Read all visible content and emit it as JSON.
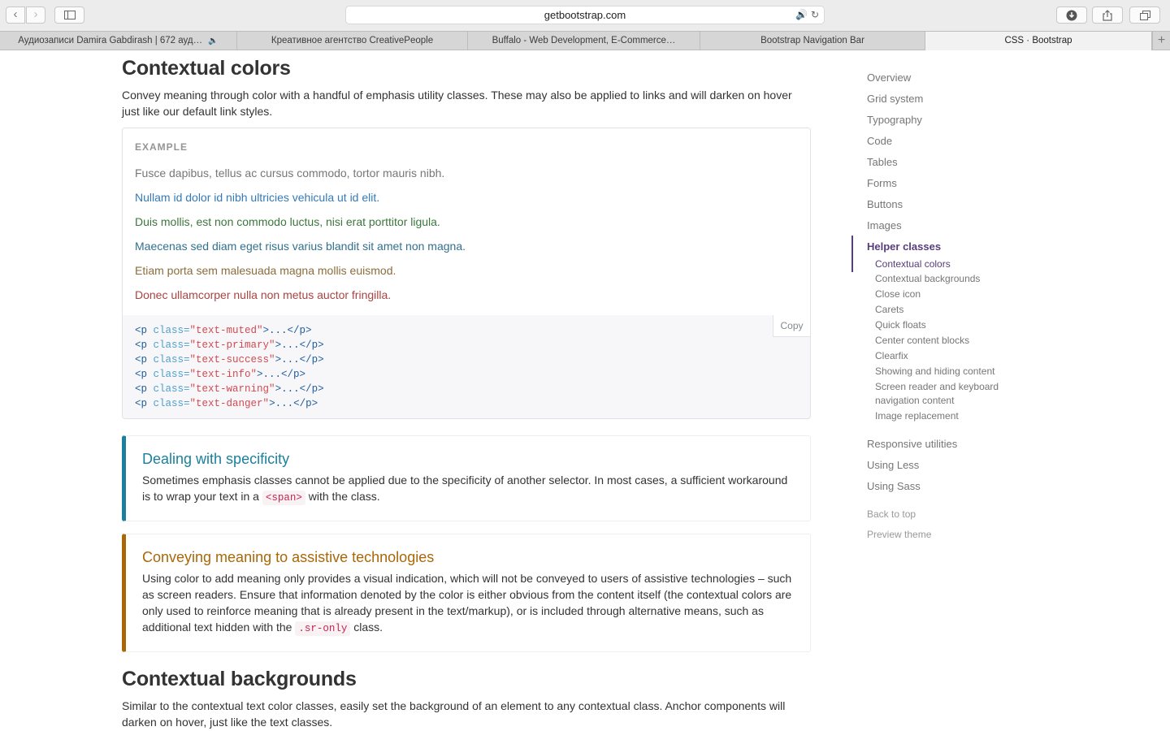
{
  "browser": {
    "url": "getbootstrap.com",
    "tabs": [
      {
        "title": "Аудиозаписи Damira Gabdirash | 672 ауд…",
        "active": false
      },
      {
        "title": "Креативное агентство CreativePeople",
        "active": false
      },
      {
        "title": "Buffalo - Web Development, E-Commerce…",
        "active": false
      },
      {
        "title": "Bootstrap Navigation Bar",
        "active": false
      },
      {
        "title": "CSS · Bootstrap",
        "active": true
      }
    ],
    "icons": {
      "back": "chevron-left-icon",
      "forward": "chevron-right-icon",
      "sidebar": "sidebar-icon",
      "audio": "speaker-icon",
      "reload": "reload-icon",
      "download": "download-icon",
      "share": "share-icon",
      "tabs": "tabs-overview-icon",
      "new_tab": "plus-icon"
    }
  },
  "page": {
    "section_title": "Contextual colors",
    "intro": "Convey meaning through color with a handful of emphasis utility classes. These may also be applied to links and will darken on hover just like our default link styles.",
    "example_label": "EXAMPLE",
    "example_lines": [
      {
        "text": "Fusce dapibus, tellus ac cursus commodo, tortor mauris nibh.",
        "color": "#777777"
      },
      {
        "text": "Nullam id dolor id nibh ultricies vehicula ut id elit.",
        "color": "#337ab7"
      },
      {
        "text": "Duis mollis, est non commodo luctus, nisi erat porttitor ligula.",
        "color": "#3c763d"
      },
      {
        "text": "Maecenas sed diam eget risus varius blandit sit amet non magna.",
        "color": "#31708f"
      },
      {
        "text": "Etiam porta sem malesuada magna mollis euismod.",
        "color": "#8a6d3b"
      },
      {
        "text": "Donec ullamcorper nulla non metus auctor fringilla.",
        "color": "#a94442"
      }
    ],
    "copy_label": "Copy",
    "code_lines": [
      {
        "tag_open": "<p ",
        "attr": "class=",
        "value": "\"text-muted\"",
        "rest": ">...</p>"
      },
      {
        "tag_open": "<p ",
        "attr": "class=",
        "value": "\"text-primary\"",
        "rest": ">...</p>"
      },
      {
        "tag_open": "<p ",
        "attr": "class=",
        "value": "\"text-success\"",
        "rest": ">...</p>"
      },
      {
        "tag_open": "<p ",
        "attr": "class=",
        "value": "\"text-info\"",
        "rest": ">...</p>"
      },
      {
        "tag_open": "<p ",
        "attr": "class=",
        "value": "\"text-warning\"",
        "rest": ">...</p>"
      },
      {
        "tag_open": "<p ",
        "attr": "class=",
        "value": "\"text-danger\"",
        "rest": ">...</p>"
      }
    ],
    "callout_info": {
      "title": "Dealing with specificity",
      "text_before": "Sometimes emphasis classes cannot be applied due to the specificity of another selector. In most cases, a sufficient workaround is to wrap your text in a ",
      "code": "<span>",
      "text_after": " with the class.",
      "accent": "#1b809e"
    },
    "callout_warning": {
      "title": "Conveying meaning to assistive technologies",
      "text_before": "Using color to add meaning only provides a visual indication, which will not be conveyed to users of assistive technologies – such as screen readers. Ensure that information denoted by the color is either obvious from the content itself (the contextual colors are only used to reinforce meaning that is already present in the text/markup), or is included through alternative means, such as additional text hidden with the ",
      "code": ".sr-only",
      "text_after": " class.",
      "accent": "#aa6708"
    },
    "next_section_title": "Contextual backgrounds",
    "next_section_intro": "Similar to the contextual text color classes, easily set the background of an element to any contextual class. Anchor components will darken on hover, just like the text classes."
  },
  "sidebar": {
    "items": [
      "Overview",
      "Grid system",
      "Typography",
      "Code",
      "Tables",
      "Forms",
      "Buttons",
      "Images",
      "Helper classes"
    ],
    "active_item": "Helper classes",
    "subitems": [
      "Contextual colors",
      "Contextual backgrounds",
      "Close icon",
      "Carets",
      "Quick floats",
      "Center content blocks",
      "Clearfix",
      "Showing and hiding content",
      "Screen reader and keyboard",
      "navigation content",
      "Image replacement"
    ],
    "active_subitem": "Contextual colors",
    "items_after": [
      "Responsive utilities",
      "Using Less",
      "Using Sass"
    ],
    "back_to_top": "Back to top",
    "preview_theme": "Preview theme",
    "accent": "#563d7c"
  }
}
